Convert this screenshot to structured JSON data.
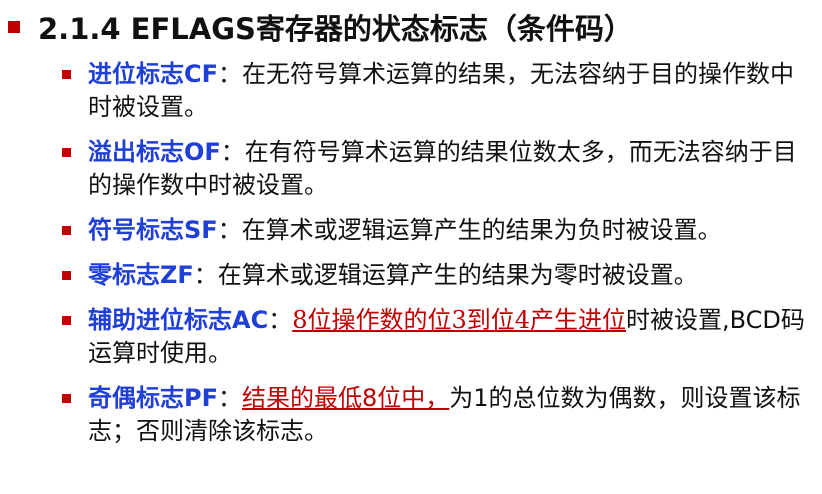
{
  "title": "2.1.4 EFLAGS寄存器的状态标志（条件码）",
  "items": [
    {
      "label": "进位标志CF",
      "sep": "：",
      "text": "在无符号算术运算的结果，无法容纳于目的操作数中时被设置。"
    },
    {
      "label": "溢出标志OF",
      "sep": "：",
      "text": "在有符号算术运算的结果位数太多，而无法容纳于目的操作数中时被设置。"
    },
    {
      "label": "符号标志SF",
      "sep": "：",
      "text": "在算术或逻辑运算产生的结果为负时被设置。"
    },
    {
      "label": "零标志ZF",
      "sep": "：",
      "text": "在算术或逻辑运算产生的结果为零时被设置。"
    },
    {
      "label": "辅助进位标志AC",
      "sep": "：",
      "highlight": "8位操作数的位3到位4产生进位",
      "text": "时被设置,BCD码运算时使用。"
    },
    {
      "label": "奇偶标志PF",
      "sep": "：",
      "highlight": "结果的最低8位中，",
      "text": "为1的总位数为偶数，则设置该标志；否则清除该标志。"
    }
  ],
  "colors": {
    "label": "#1f3fd6",
    "bullet": "#c00000",
    "highlight": "#c00000",
    "text": "#111111"
  }
}
